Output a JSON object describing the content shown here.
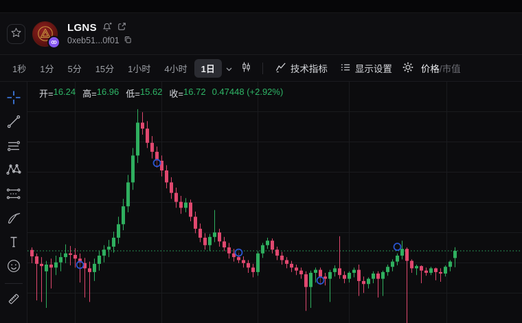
{
  "header": {
    "symbol": "LGNS",
    "address": "0xeb51...0f01"
  },
  "toolbar": {
    "timeframes": [
      "1秒",
      "1分",
      "5分",
      "15分",
      "1小时",
      "4小时",
      "1日"
    ],
    "selected_timeframe": "1日",
    "indicators_label": "技术指标",
    "display_settings_label": "显示设置",
    "price_label": "价格",
    "separator": "/",
    "marketcap_label": "市值"
  },
  "legend": {
    "open_label": "开=",
    "open": "16.24",
    "high_label": "高=",
    "high": "16.96",
    "low_label": "低=",
    "low": "15.62",
    "close_label": "收=",
    "close": "16.72",
    "change_abs": "0.47448",
    "change_pct": "(+2.92%)"
  },
  "colors": {
    "up": "#2faf5f",
    "down": "#e0486f",
    "price_line": "#2eb566",
    "marker": "#2a55d0",
    "crosshair_accent": "#4285f7",
    "grid": "#1a1b1e"
  },
  "chart_data": {
    "type": "candlestick",
    "timeframe": "1日",
    "price_line": 16.72,
    "ylim": [
      11.5,
      26.5
    ],
    "grid": true,
    "legend_ohlc": {
      "open": 16.24,
      "high": 16.96,
      "low": 15.62,
      "close": 16.72,
      "change": 0.47448,
      "change_pct": 2.92
    },
    "candles": [
      [
        16.78,
        16.95,
        15.9,
        16.35
      ],
      [
        16.35,
        16.55,
        13.4,
        15.85
      ],
      [
        15.85,
        16.3,
        13.3,
        15.7
      ],
      [
        15.35,
        16.05,
        12.9,
        15.8
      ],
      [
        15.8,
        16.2,
        14.2,
        15.6
      ],
      [
        15.6,
        16.4,
        15.1,
        15.95
      ],
      [
        15.95,
        16.6,
        15.35,
        16.3
      ],
      [
        16.3,
        17.15,
        15.9,
        16.55
      ],
      [
        16.55,
        17.05,
        15.75,
        16.45
      ],
      [
        16.45,
        16.9,
        15.6,
        16.2
      ],
      [
        16.2,
        16.55,
        14.6,
        15.9
      ],
      [
        15.9,
        16.25,
        13.6,
        15.55
      ],
      [
        15.55,
        16.0,
        13.3,
        15.3
      ],
      [
        15.3,
        16.2,
        14.7,
        15.85
      ],
      [
        15.85,
        16.75,
        15.4,
        16.4
      ],
      [
        16.4,
        17.1,
        15.95,
        16.8
      ],
      [
        16.8,
        17.45,
        16.3,
        17.0
      ],
      [
        17.0,
        18.0,
        16.6,
        17.6
      ],
      [
        17.6,
        19.0,
        17.2,
        18.5
      ],
      [
        18.5,
        20.2,
        18.1,
        19.7
      ],
      [
        19.7,
        21.8,
        19.3,
        21.3
      ],
      [
        21.3,
        23.6,
        20.8,
        23.1
      ],
      [
        23.1,
        26.2,
        22.6,
        25.3
      ],
      [
        25.3,
        26.0,
        24.5,
        24.9
      ],
      [
        24.9,
        25.4,
        23.6,
        23.95
      ],
      [
        23.95,
        24.4,
        22.9,
        23.35
      ],
      [
        23.35,
        23.7,
        22.3,
        22.75
      ],
      [
        22.75,
        23.1,
        21.7,
        22.1
      ],
      [
        22.1,
        22.45,
        20.9,
        21.3
      ],
      [
        21.3,
        21.65,
        20.2,
        20.6
      ],
      [
        20.6,
        20.95,
        19.6,
        20.0
      ],
      [
        20.0,
        20.4,
        19.2,
        19.6
      ],
      [
        19.6,
        20.25,
        19.3,
        19.95
      ],
      [
        19.95,
        20.15,
        18.7,
        19.0
      ],
      [
        19.0,
        19.35,
        17.9,
        18.2
      ],
      [
        18.2,
        18.55,
        17.3,
        17.6
      ],
      [
        17.6,
        17.9,
        16.8,
        17.1
      ],
      [
        17.1,
        17.85,
        16.7,
        17.65
      ],
      [
        17.65,
        19.45,
        17.3,
        17.95
      ],
      [
        17.95,
        18.2,
        17.0,
        17.35
      ],
      [
        17.35,
        17.65,
        16.7,
        16.95
      ],
      [
        16.95,
        17.25,
        16.2,
        16.55
      ],
      [
        16.55,
        16.85,
        16.0,
        16.3
      ],
      [
        16.3,
        16.6,
        15.9,
        16.1
      ],
      [
        16.1,
        16.35,
        15.6,
        15.9
      ],
      [
        15.9,
        16.1,
        15.25,
        15.6
      ],
      [
        15.6,
        15.85,
        14.95,
        15.3
      ],
      [
        15.3,
        16.7,
        15.05,
        16.55
      ],
      [
        16.55,
        17.25,
        16.25,
        17.1
      ],
      [
        17.1,
        17.6,
        16.85,
        17.4
      ],
      [
        17.4,
        17.55,
        16.55,
        16.8
      ],
      [
        16.8,
        17.0,
        16.1,
        16.4
      ],
      [
        16.4,
        16.65,
        15.8,
        16.1
      ],
      [
        16.1,
        16.3,
        15.55,
        15.85
      ],
      [
        15.85,
        16.05,
        15.3,
        15.6
      ],
      [
        15.6,
        15.8,
        15.1,
        15.4
      ],
      [
        15.4,
        15.6,
        14.85,
        15.15
      ],
      [
        15.15,
        15.35,
        12.7,
        14.3
      ],
      [
        14.3,
        15.4,
        12.9,
        15.25
      ],
      [
        15.25,
        15.6,
        14.6,
        15.45
      ],
      [
        15.45,
        15.6,
        14.45,
        15.0
      ],
      [
        15.0,
        15.25,
        14.4,
        14.85
      ],
      [
        14.85,
        15.45,
        13.3,
        15.3
      ],
      [
        15.3,
        15.75,
        15.0,
        15.55
      ],
      [
        15.55,
        17.7,
        14.85,
        15.1
      ],
      [
        15.1,
        15.35,
        14.55,
        14.85
      ],
      [
        14.85,
        15.35,
        14.6,
        15.25
      ],
      [
        15.25,
        15.6,
        14.95,
        15.45
      ],
      [
        15.45,
        15.8,
        13.7,
        14.7
      ],
      [
        14.7,
        15.0,
        13.9,
        14.5
      ],
      [
        14.5,
        14.95,
        14.2,
        14.85
      ],
      [
        14.85,
        15.35,
        14.55,
        15.2
      ],
      [
        15.2,
        15.35,
        13.6,
        14.85
      ],
      [
        14.85,
        15.4,
        13.7,
        15.3
      ],
      [
        15.3,
        15.8,
        15.05,
        15.65
      ],
      [
        15.65,
        16.15,
        15.35,
        16.0
      ],
      [
        16.0,
        16.55,
        15.75,
        16.4
      ],
      [
        16.4,
        17.4,
        16.15,
        16.85
      ],
      [
        16.85,
        16.95,
        11.5,
        16.05
      ],
      [
        16.05,
        16.15,
        15.25,
        15.55
      ],
      [
        15.55,
        15.8,
        15.1,
        15.7
      ],
      [
        15.7,
        15.75,
        14.55,
        15.4
      ],
      [
        15.4,
        15.6,
        15.05,
        15.25
      ],
      [
        15.25,
        15.65,
        15.1,
        15.55
      ],
      [
        15.55,
        15.6,
        14.75,
        15.3
      ],
      [
        15.3,
        15.55,
        14.65,
        15.2
      ],
      [
        15.2,
        15.75,
        15.0,
        15.65
      ],
      [
        15.65,
        16.1,
        15.35,
        16.0
      ],
      [
        16.24,
        16.96,
        15.62,
        16.72
      ]
    ],
    "markers": [
      {
        "index": 10,
        "price": 15.78
      },
      {
        "index": 26,
        "price": 22.6
      },
      {
        "index": 43,
        "price": 16.6
      },
      {
        "index": 60,
        "price": 14.74
      },
      {
        "index": 76,
        "price": 16.99
      }
    ]
  }
}
